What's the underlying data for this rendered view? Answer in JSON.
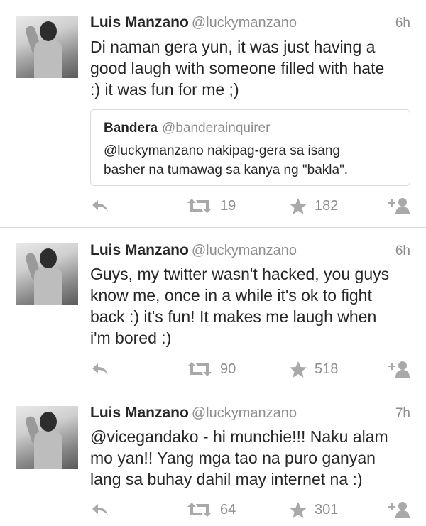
{
  "tweets": [
    {
      "name": "Luis Manzano",
      "handle": "@luckymanzano",
      "time": "6h",
      "lines": [
        "Di naman gera yun, it was just having a",
        "good laugh with someone filled with hate",
        ":) it was fun for me ;)"
      ],
      "quote": {
        "name": "Bandera",
        "handle": "@banderainquirer",
        "lines": [
          "@luckymanzano nakipag-gera sa isang",
          "basher na tumawag sa kanya ng \"bakla\"."
        ]
      },
      "retweets": "19",
      "favorites": "182"
    },
    {
      "name": "Luis Manzano",
      "handle": "@luckymanzano",
      "time": "6h",
      "lines": [
        "Guys, my twitter wasn't hacked, you guys",
        "know me, once in a while it's ok to fight",
        "back :) it's fun! It makes me laugh when",
        "i'm bored :)"
      ],
      "retweets": "90",
      "favorites": "518"
    },
    {
      "name": "Luis Manzano",
      "handle": "@luckymanzano",
      "time": "7h",
      "lines": [
        "@vicegandako - hi munchie!!! Naku alam",
        "mo yan!! Yang mga tao na puro ganyan",
        "lang sa buhay dahil may internet na :)"
      ],
      "retweets": "64",
      "favorites": "301"
    }
  ],
  "icons": {
    "reply": "reply-arrow-icon",
    "retweet": "retweet-icon",
    "favorite": "star-icon",
    "follow": "add-user-icon"
  },
  "colors": {
    "icon_gray": "#a9a9a9",
    "meta_gray": "#8d8d8d",
    "text": "#262626",
    "divider": "#dcdcdc"
  }
}
